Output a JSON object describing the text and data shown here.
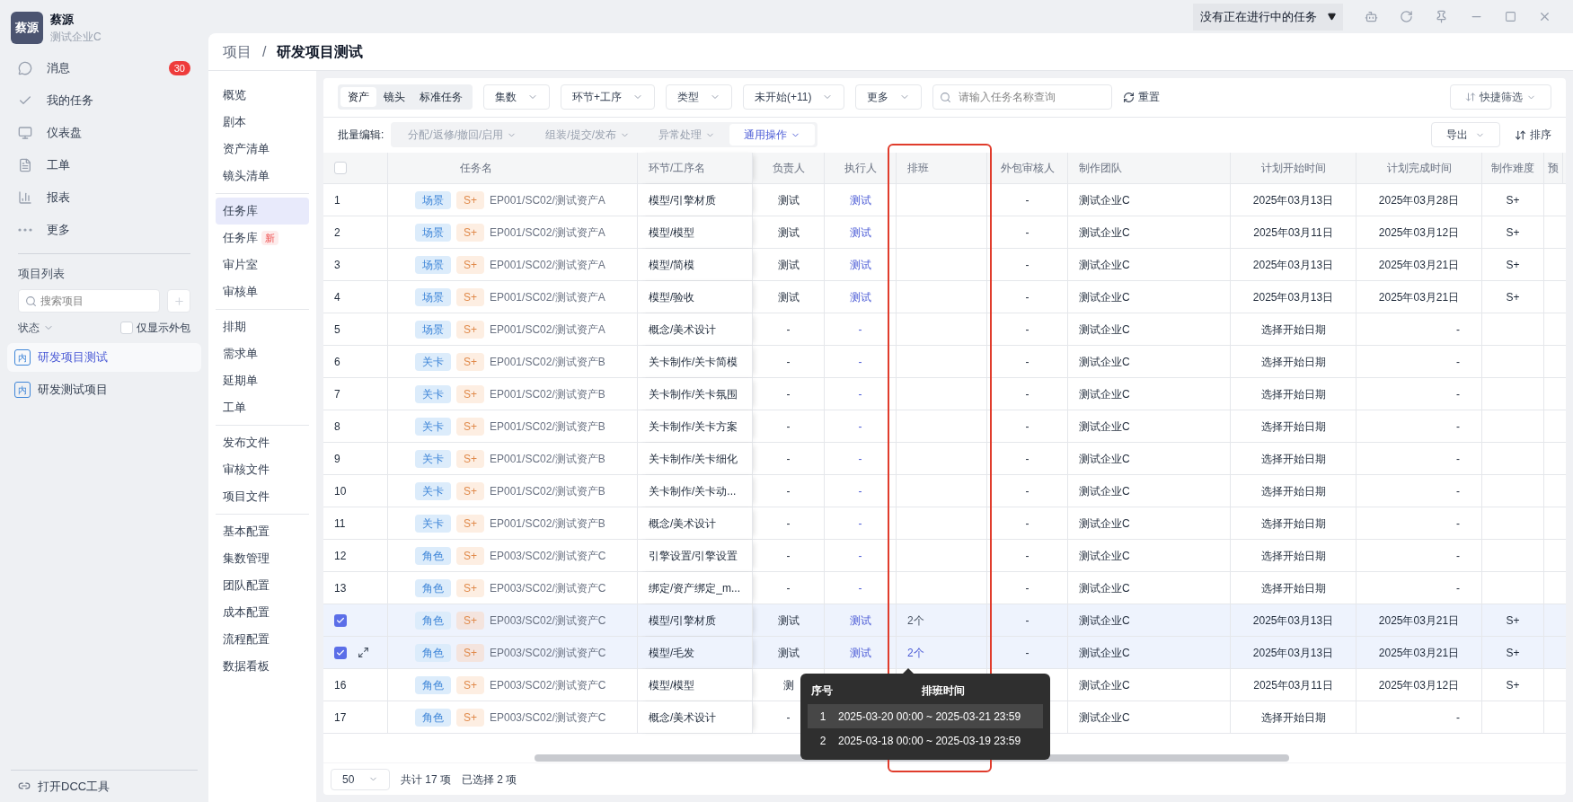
{
  "title_bar": {
    "task_status": "没有正在进行中的任务"
  },
  "workspace": {
    "logo": "蔡源",
    "name": "蔡源",
    "company": "测试企业C"
  },
  "nav": [
    {
      "kind": "message",
      "label": "消息",
      "badge": "30"
    },
    {
      "kind": "task",
      "label": "我的任务"
    },
    {
      "kind": "dashboard",
      "label": "仪表盘"
    },
    {
      "kind": "ticket",
      "label": "工单"
    },
    {
      "kind": "report",
      "label": "报表"
    },
    {
      "kind": "more",
      "label": "更多"
    }
  ],
  "project_list": {
    "title": "项目列表",
    "search": {
      "placeholder": "搜索项目"
    },
    "status_filter": "状态",
    "outsource_only": {
      "label": "仅显示外包",
      "checked": false
    },
    "projects": [
      {
        "tag": "内",
        "name": "研发项目测试",
        "selected": true
      },
      {
        "tag": "内",
        "name": "研发测试项目",
        "selected": false
      }
    ]
  },
  "dcc_tool": "打开DCC工具",
  "breadcrumb": {
    "parent": "项目",
    "separator": "/",
    "current": "研发项目测试"
  },
  "subnav": [
    [
      {
        "label": "概览",
        "selected": false
      },
      {
        "label": "剧本",
        "selected": false
      },
      {
        "label": "资产清单",
        "selected": false
      },
      {
        "label": "镜头清单",
        "selected": false
      }
    ],
    [
      {
        "label": "任务库",
        "selected": true
      },
      {
        "label": "任务库",
        "badge": "新",
        "selected": false
      },
      {
        "label": "审片室",
        "selected": false
      },
      {
        "label": "审核单",
        "selected": false
      }
    ],
    [
      {
        "label": "排期",
        "selected": false
      },
      {
        "label": "需求单",
        "selected": false
      },
      {
        "label": "延期单",
        "selected": false
      },
      {
        "label": "工单",
        "selected": false
      }
    ],
    [
      {
        "label": "发布文件",
        "selected": false
      },
      {
        "label": "审核文件",
        "selected": false
      },
      {
        "label": "项目文件",
        "selected": false
      }
    ],
    [
      {
        "label": "基本配置",
        "selected": false
      },
      {
        "label": "集数管理",
        "selected": false
      },
      {
        "label": "团队配置",
        "selected": false
      },
      {
        "label": "成本配置",
        "selected": false
      },
      {
        "label": "流程配置",
        "selected": false
      },
      {
        "label": "数据看板",
        "selected": false
      }
    ]
  ],
  "toolbar": {
    "tabs": [
      {
        "label": "资产",
        "selected": true
      },
      {
        "label": "镜头",
        "selected": false
      },
      {
        "label": "标准任务",
        "selected": false
      }
    ],
    "filters": [
      "集数",
      "环节+工序",
      "类型",
      "未开始(+11)",
      "更多"
    ],
    "search": {
      "placeholder": "请输入任务名称查询"
    },
    "reset": "重置",
    "quick_filter": "快捷筛选"
  },
  "batch": {
    "label": "批量编辑:",
    "actions": [
      {
        "label": "分配/返修/撤回/启用",
        "selected": false
      },
      {
        "label": "组装/提交/发布",
        "selected": false
      },
      {
        "label": "异常处理",
        "selected": false
      },
      {
        "label": "通用操作",
        "selected": true
      }
    ],
    "export": "导出",
    "sort": "排序"
  },
  "table": {
    "all_selected": false,
    "columns": [
      "任务名",
      "环节/工序名",
      "负责人",
      "执行人",
      "排班",
      "外包审核人",
      "制作团队",
      "计划开始时间",
      "计划完成时间",
      "制作难度",
      "预"
    ],
    "rows": [
      {
        "index": "1",
        "selected": false,
        "hovered": false,
        "type": "场景",
        "grade": "S+",
        "task": "EP001/SC02/测试资产A",
        "step": "模型/引擎材质",
        "owner": "测试",
        "executor": "测试",
        "reviewer": "-",
        "team": "测试企业C",
        "start": "2025年03月13日",
        "end": "2025年03月28日",
        "difficulty": "S+"
      },
      {
        "index": "2",
        "selected": false,
        "hovered": false,
        "type": "场景",
        "grade": "S+",
        "task": "EP001/SC02/测试资产A",
        "step": "模型/模型",
        "owner": "测试",
        "executor": "测试",
        "reviewer": "-",
        "team": "测试企业C",
        "start": "2025年03月11日",
        "end": "2025年03月12日",
        "difficulty": "S+"
      },
      {
        "index": "3",
        "selected": false,
        "hovered": false,
        "type": "场景",
        "grade": "S+",
        "task": "EP001/SC02/测试资产A",
        "step": "模型/简模",
        "owner": "测试",
        "executor": "测试",
        "reviewer": "-",
        "team": "测试企业C",
        "start": "2025年03月13日",
        "end": "2025年03月21日",
        "difficulty": "S+"
      },
      {
        "index": "4",
        "selected": false,
        "hovered": false,
        "type": "场景",
        "grade": "S+",
        "task": "EP001/SC02/测试资产A",
        "step": "模型/验收",
        "owner": "测试",
        "executor": "测试",
        "reviewer": "-",
        "team": "测试企业C",
        "start": "2025年03月13日",
        "end": "2025年03月21日",
        "difficulty": "S+"
      },
      {
        "index": "5",
        "selected": false,
        "hovered": false,
        "type": "场景",
        "grade": "S+",
        "task": "EP001/SC02/测试资产A",
        "step": "概念/美术设计",
        "owner": "-",
        "executor": "-",
        "reviewer": "-",
        "team": "测试企业C",
        "start": "选择开始日期",
        "end": "-"
      },
      {
        "index": "6",
        "selected": false,
        "hovered": false,
        "type": "关卡",
        "grade": "S+",
        "task": "EP001/SC02/测试资产B",
        "step": "关卡制作/关卡简模",
        "owner": "-",
        "executor": "-",
        "reviewer": "-",
        "team": "测试企业C",
        "start": "选择开始日期",
        "end": "-"
      },
      {
        "index": "7",
        "selected": false,
        "hovered": false,
        "type": "关卡",
        "grade": "S+",
        "task": "EP001/SC02/测试资产B",
        "step": "关卡制作/关卡氛围",
        "owner": "-",
        "executor": "-",
        "reviewer": "-",
        "team": "测试企业C",
        "start": "选择开始日期",
        "end": "-"
      },
      {
        "index": "8",
        "selected": false,
        "hovered": false,
        "type": "关卡",
        "grade": "S+",
        "task": "EP001/SC02/测试资产B",
        "step": "关卡制作/关卡方案",
        "owner": "-",
        "executor": "-",
        "reviewer": "-",
        "team": "测试企业C",
        "start": "选择开始日期",
        "end": "-"
      },
      {
        "index": "9",
        "selected": false,
        "hovered": false,
        "type": "关卡",
        "grade": "S+",
        "task": "EP001/SC02/测试资产B",
        "step": "关卡制作/关卡细化",
        "owner": "-",
        "executor": "-",
        "reviewer": "-",
        "team": "测试企业C",
        "start": "选择开始日期",
        "end": "-"
      },
      {
        "index": "10",
        "selected": false,
        "hovered": false,
        "type": "关卡",
        "grade": "S+",
        "task": "EP001/SC02/测试资产B",
        "step": "关卡制作/关卡动...",
        "owner": "-",
        "executor": "-",
        "reviewer": "-",
        "team": "测试企业C",
        "start": "选择开始日期",
        "end": "-"
      },
      {
        "index": "11",
        "selected": false,
        "hovered": false,
        "type": "关卡",
        "grade": "S+",
        "task": "EP001/SC02/测试资产B",
        "step": "概念/美术设计",
        "owner": "-",
        "executor": "-",
        "reviewer": "-",
        "team": "测试企业C",
        "start": "选择开始日期",
        "end": "-"
      },
      {
        "index": "12",
        "selected": false,
        "hovered": false,
        "type": "角色",
        "grade": "S+",
        "task": "EP003/SC02/测试资产C",
        "step": "引擎设置/引擎设置",
        "owner": "-",
        "executor": "-",
        "reviewer": "-",
        "team": "测试企业C",
        "start": "选择开始日期",
        "end": "-"
      },
      {
        "index": "13",
        "selected": false,
        "hovered": false,
        "type": "角色",
        "grade": "S+",
        "task": "EP003/SC02/测试资产C",
        "step": "绑定/资产绑定_m...",
        "owner": "-",
        "executor": "-",
        "reviewer": "-",
        "team": "测试企业C",
        "start": "选择开始日期",
        "end": "-"
      },
      {
        "selected": true,
        "hovered": false,
        "type": "角色",
        "grade": "S+",
        "task": "EP003/SC02/测试资产C",
        "step": "模型/引擎材质",
        "owner": "测试",
        "executor": "测试",
        "schedule": "2个",
        "reviewer": "-",
        "team": "测试企业C",
        "start": "2025年03月13日",
        "end": "2025年03月21日",
        "difficulty": "S+"
      },
      {
        "selected": true,
        "hovered": true,
        "type": "角色",
        "grade": "S+",
        "task": "EP003/SC02/测试资产C",
        "step": "模型/毛发",
        "owner": "测试",
        "executor": "测试",
        "schedule": "2个",
        "reviewer": "-",
        "team": "测试企业C",
        "start": "2025年03月13日",
        "end": "2025年03月21日",
        "difficulty": "S+"
      },
      {
        "index": "16",
        "selected": false,
        "hovered": false,
        "type": "角色",
        "grade": "S+",
        "task": "EP003/SC02/测试资产C",
        "step": "模型/模型",
        "owner": "测",
        "team": "测试企业C",
        "start": "2025年03月11日",
        "end": "2025年03月12日",
        "difficulty": "S+"
      },
      {
        "index": "17",
        "selected": false,
        "hovered": false,
        "type": "角色",
        "grade": "S+",
        "task": "EP003/SC02/测试资产C",
        "step": "概念/美术设计",
        "owner": "-",
        "team": "测试企业C",
        "start": "选择开始日期",
        "end": "-"
      }
    ]
  },
  "schedule_tooltip": {
    "columns": [
      "序号",
      "排班时间"
    ],
    "rows": [
      {
        "index": "1",
        "time": "2025-03-20 00:00 ~ 2025-03-21 23:59",
        "hovered": true
      },
      {
        "index": "2",
        "time": "2025-03-18 00:00 ~ 2025-03-19 23:59",
        "hovered": false
      }
    ]
  },
  "annotation": {
    "kind": "frame"
  },
  "footer": {
    "page_size": "50",
    "total": "共计 17 项",
    "selected": "已选择 2 项"
  }
}
